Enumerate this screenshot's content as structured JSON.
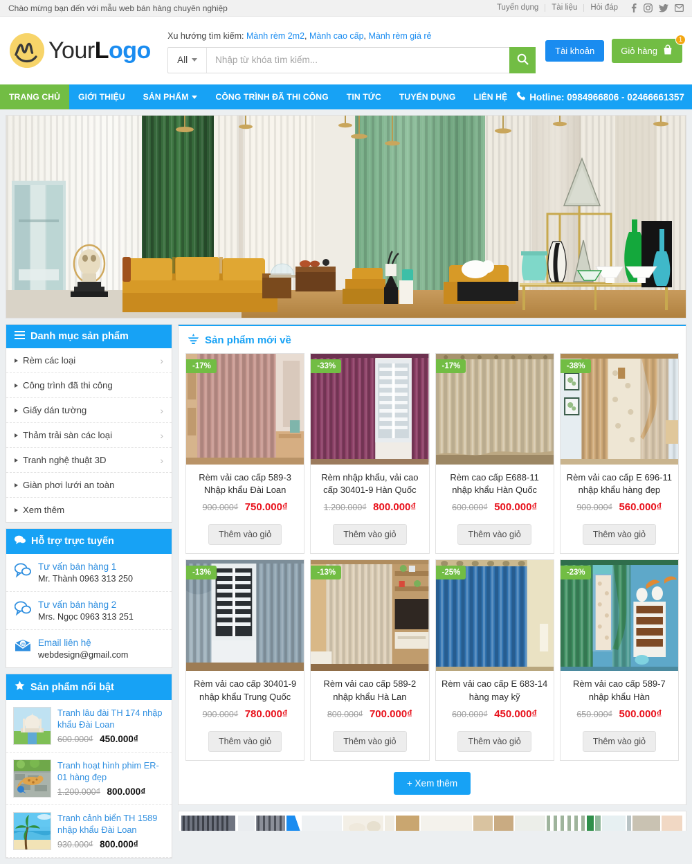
{
  "topbar": {
    "welcome": "Chào mừng bạn đến với mẫu web bán hàng chuyên nghiệp",
    "links": [
      {
        "label": "Tuyển dụng"
      },
      {
        "label": "Tài liệu"
      },
      {
        "label": "Hỏi đáp"
      }
    ],
    "socials": [
      {
        "name": "facebook-icon"
      },
      {
        "name": "instagram-icon"
      },
      {
        "name": "twitter-icon"
      },
      {
        "name": "email-icon"
      }
    ]
  },
  "header": {
    "logo": {
      "part1": "Your",
      "part2": "L",
      "part3": "ogo"
    },
    "trend_label": "Xu hướng tìm kiếm:",
    "trend_links": [
      "Mành rèm 2m2",
      "Mành cao cấp",
      "Mành rèm giá rẻ"
    ],
    "search": {
      "category": "All",
      "placeholder": "Nhập từ khóa tìm kiếm...",
      "value": "",
      "button_icon": "search-icon"
    },
    "account_label": "Tài khoản",
    "cart_label": "Giỏ hàng",
    "cart_count": "1",
    "accent_blue": "#1a8cf0",
    "accent_green": "#72bd44"
  },
  "nav": {
    "items": [
      {
        "label": "TRANG CHỦ",
        "active": true,
        "has_caret": false
      },
      {
        "label": "GIỚI THIỆU",
        "active": false,
        "has_caret": false
      },
      {
        "label": "SẢN PHẨM",
        "active": false,
        "has_caret": true
      },
      {
        "label": "CÔNG TRÌNH ĐÃ THI CÔNG",
        "active": false,
        "has_caret": false
      },
      {
        "label": "TIN TỨC",
        "active": false,
        "has_caret": false
      },
      {
        "label": "TUYỂN DỤNG",
        "active": false,
        "has_caret": false
      },
      {
        "label": "LIÊN HỆ",
        "active": false,
        "has_caret": false
      }
    ],
    "hotline": "Hotline: 0984966806 - 02466661357",
    "bar_color": "#17a2f5"
  },
  "sidebar": {
    "categories": {
      "title": "Danh mục sản phẩm",
      "icon": "hamburger-icon",
      "items": [
        {
          "label": "Rèm các loại",
          "has_chevron": true
        },
        {
          "label": "Công trình đã thi công",
          "has_chevron": false
        },
        {
          "label": "Giấy dán tường",
          "has_chevron": true
        },
        {
          "label": "Thảm trải sàn các loại",
          "has_chevron": true
        },
        {
          "label": "Tranh nghệ thuật 3D",
          "has_chevron": true
        },
        {
          "label": "Giàn phơi lưới an toàn",
          "has_chevron": false
        },
        {
          "label": "Xem thêm",
          "has_chevron": false
        }
      ]
    },
    "support": {
      "title": "Hỗ trợ trực tuyến",
      "icon": "chat-icon",
      "items": [
        {
          "name": "Tư vấn bán hàng 1",
          "detail": "Mr. Thành 0963 313 250",
          "icon": "chat-bubbles-icon"
        },
        {
          "name": "Tư vấn bán hàng 2",
          "detail": "Mrs. Ngọc 0963 313 251",
          "icon": "chat-bubbles-icon"
        },
        {
          "name": "Email liên hệ",
          "detail": "webdesign@gmail.com",
          "icon": "envelope-icon"
        }
      ]
    },
    "featured": {
      "title": "Sản phẩm nổi bật",
      "icon": "star-icon",
      "items": [
        {
          "title": "Tranh lâu đài TH 174 nhập khẩu Đài Loan",
          "price_old": "600.000₫",
          "price_new": "450.000₫",
          "thumb": "taj-mahal"
        },
        {
          "title": "Tranh hoạt hình phim ER-01 hàng đẹp",
          "price_old": "1.200.000₫",
          "price_new": "800.000₫",
          "thumb": "cartoon-animals"
        },
        {
          "title": "Tranh cảnh biển TH 1589 nhập khẩu Đài Loan",
          "price_old": "930.000₫",
          "price_new": "800.000₫",
          "thumb": "beach"
        }
      ]
    }
  },
  "main": {
    "section_title": "Sản phẩm mới về",
    "section_icon": "new-arrival-icon",
    "add_to_cart_label": "Thêm vào giỏ",
    "view_more_label": "+ Xem thêm",
    "products": [
      {
        "badge": "-17%",
        "title": "Rèm vải cao cấp 589-3 Nhập khẩu Đài Loan",
        "price_old": "900.000₫",
        "price_new": "750.000₫",
        "img": "curtain-pink"
      },
      {
        "badge": "-33%",
        "title": "Rèm nhập khẩu, vải cao cấp 30401-9 Hàn Quốc",
        "price_old": "1.200.000₫",
        "price_new": "800.000₫",
        "img": "curtain-purple"
      },
      {
        "badge": "-17%",
        "title": "Rèm cao cấp E688-11 nhập khẩu Hàn Quốc",
        "price_old": "600.000₫",
        "price_new": "500.000₫",
        "img": "curtain-cream"
      },
      {
        "badge": "-38%",
        "title": "Rèm vải cao cấp E 696-11 nhập khẩu hàng đẹp",
        "price_old": "900.000₫",
        "price_new": "560.000₫",
        "img": "curtain-tan"
      },
      {
        "badge": "-13%",
        "title": "Rèm vải cao cấp 30401-9 nhập khẩu Trung Quốc",
        "price_old": "900.000₫",
        "price_new": "780.000₫",
        "img": "curtain-gray"
      },
      {
        "badge": "-13%",
        "title": "Rèm vải cao cấp 589-2 nhập khẩu Hà Lan",
        "price_old": "800.000₫",
        "price_new": "700.000₫",
        "img": "curtain-beige"
      },
      {
        "badge": "-25%",
        "title": "Rèm vải cao cấp E 683-14 hàng may kỹ",
        "price_old": "600.000₫",
        "price_new": "450.000₫",
        "img": "curtain-blue"
      },
      {
        "badge": "-23%",
        "title": "Rèm vải cao cấp 589-7 nhập khẩu Hàn",
        "price_old": "650.000₫",
        "price_new": "500.000₫",
        "img": "curtain-green"
      }
    ]
  },
  "colors": {
    "blue": "#17a2f5",
    "green": "#72bd44",
    "red": "#e8121c",
    "link": "#2f8fe0",
    "badge_orange": "#f3a712"
  }
}
